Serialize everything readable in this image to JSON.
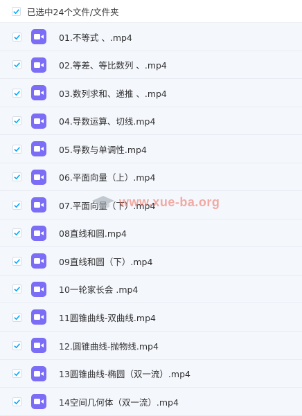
{
  "header": {
    "title": "已选中24个文件/文件夹",
    "checked": true
  },
  "files": [
    {
      "name": "01.不等式 、.mp4",
      "checked": true,
      "icon": "video-file-icon"
    },
    {
      "name": "02.等差、等比数列 、.mp4",
      "checked": true,
      "icon": "video-file-icon"
    },
    {
      "name": "03.数列求和、递推 、.mp4",
      "checked": true,
      "icon": "video-file-icon"
    },
    {
      "name": "04.导数运算、切线.mp4",
      "checked": true,
      "icon": "video-file-icon"
    },
    {
      "name": "05.导数与单调性.mp4",
      "checked": true,
      "icon": "video-file-icon"
    },
    {
      "name": "06.平面向量（上）.mp4",
      "checked": true,
      "icon": "video-file-icon"
    },
    {
      "name": "07.平面向量（下）.mp4",
      "checked": true,
      "icon": "video-file-icon"
    },
    {
      "name": "08直线和圆.mp4",
      "checked": true,
      "icon": "video-file-icon"
    },
    {
      "name": "09直线和圆（下）.mp4",
      "checked": true,
      "icon": "video-file-icon"
    },
    {
      "name": "10一轮家长会 .mp4",
      "checked": true,
      "icon": "video-file-icon"
    },
    {
      "name": "11圆锥曲线-双曲线.mp4",
      "checked": true,
      "icon": "video-file-icon"
    },
    {
      "name": "12.圆锥曲线-抛物线.mp4",
      "checked": true,
      "icon": "video-file-icon"
    },
    {
      "name": "13圆锥曲线-椭圆（双一流）.mp4",
      "checked": true,
      "icon": "video-file-icon"
    },
    {
      "name": "14空间几何体（双一流）.mp4",
      "checked": true,
      "icon": "video-file-icon"
    }
  ],
  "watermark": {
    "text": "www.xue-ba.org"
  },
  "colors": {
    "check": "#06a7ff",
    "video_icon": "#7b6df6",
    "row_bg": "#f4f7fc",
    "watermark": "#f06a5a"
  }
}
